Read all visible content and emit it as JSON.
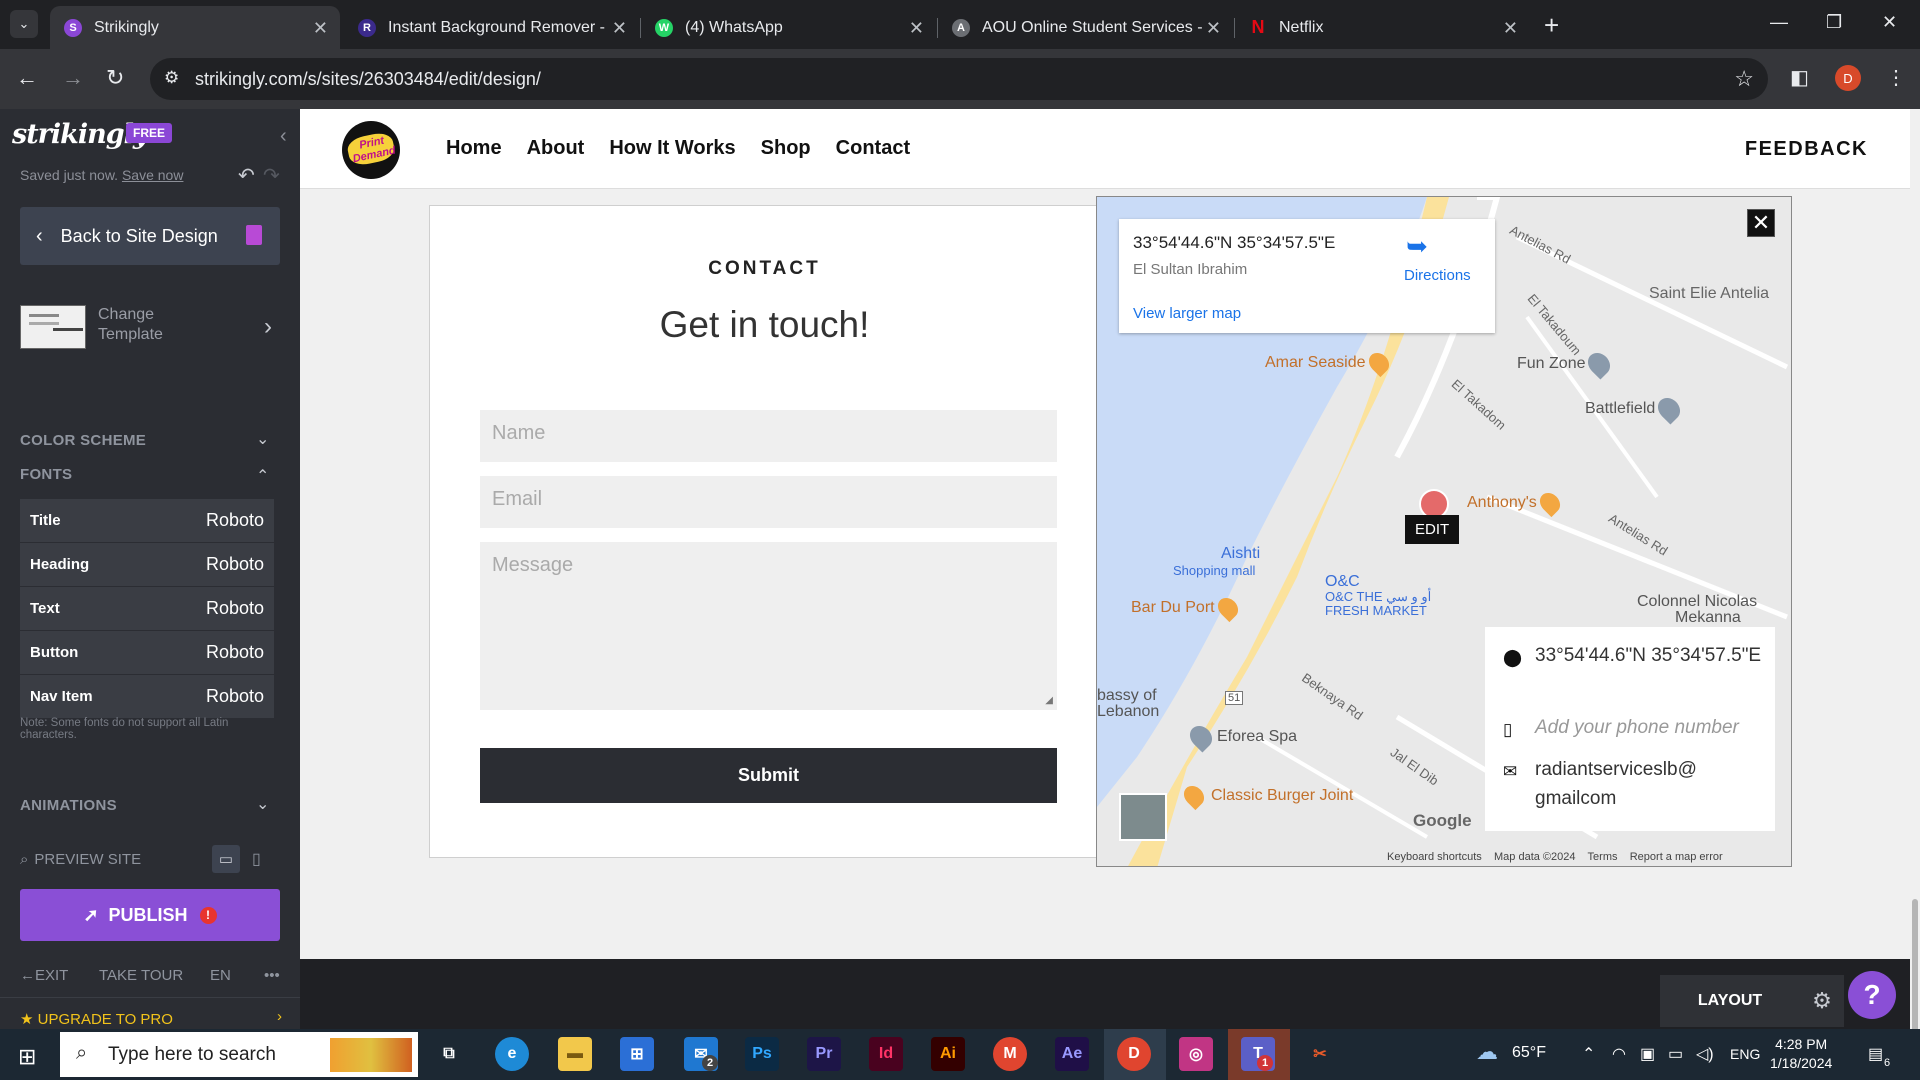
{
  "browser": {
    "tabs": [
      {
        "title": "Strikingly",
        "favicon": "S",
        "color": "#8b47d6",
        "active": true
      },
      {
        "title": "Instant Background Remover - I",
        "favicon": "R",
        "color": "#3b2a8c",
        "active": false
      },
      {
        "title": "(4) WhatsApp",
        "favicon": "W",
        "color": "#25d366",
        "active": false
      },
      {
        "title": "AOU Online Student Services - (",
        "favicon": "A",
        "color": "#6b6e73",
        "active": false
      },
      {
        "title": "Netflix",
        "favicon": "N",
        "color": "#e50914",
        "active": false
      }
    ],
    "url": "strikingly.com/s/sites/26303484/edit/design/",
    "profile_initial": "D"
  },
  "sidebar": {
    "brand": "strikingly",
    "badge": "FREE",
    "saved_text": "Saved just now.",
    "save_now": "Save now",
    "back_label": "Back to Site Design",
    "template_label_1": "Change",
    "template_label_2": "Template",
    "color_scheme": "COLOR SCHEME",
    "fonts_heading": "FONTS",
    "fonts": [
      {
        "key": "Title",
        "value": "Roboto"
      },
      {
        "key": "Heading",
        "value": "Roboto"
      },
      {
        "key": "Text",
        "value": "Roboto"
      },
      {
        "key": "Button",
        "value": "Roboto"
      },
      {
        "key": "Nav Item",
        "value": "Roboto"
      }
    ],
    "note": "Note: Some fonts do not support all Latin characters.",
    "animations": "ANIMATIONS",
    "preview": "PREVIEW SITE",
    "publish": "PUBLISH",
    "exit": "EXIT",
    "tour": "TAKE TOUR",
    "lang": "EN",
    "more": "•••",
    "upgrade": "UPGRADE TO PRO"
  },
  "site": {
    "logo_text": "Print Demand",
    "nav": [
      "Home",
      "About",
      "How It Works",
      "Shop",
      "Contact"
    ],
    "feedback": "FEEDBACK",
    "contact_label": "CONTACT",
    "contact_title": "Get in touch!",
    "name_placeholder": "Name",
    "email_placeholder": "Email",
    "message_placeholder": "Message",
    "submit": "Submit"
  },
  "map": {
    "card_coord": "33°54'44.6\"N 35°34'57.5\"E",
    "card_place": "El Sultan Ibrahim",
    "directions": "Directions",
    "larger_map": "View larger map",
    "places": [
      "Antelias Rd",
      "Saint Elie Antelia",
      "El Takadoum",
      "Amar Seaside",
      "Fun Zone",
      "Battlefield",
      "El Takadom",
      "Anthony's",
      "Antelias Rd",
      "Aishti",
      "Shopping mall",
      "O&C",
      "O&C THE أو و سي",
      "FRESH MARKET",
      "Bar Du Port",
      "Colonnel Nicolas",
      "Mekanna",
      "bassy of",
      "Lebanon",
      "Beknaya Rd",
      "Eforea Spa",
      "Jal El Dib",
      "Classic Burger Joint",
      "51"
    ],
    "edit": "EDIT",
    "info_coord": "33°54'44.6\"N 35°34'57.5\"E",
    "info_phone": "Add your phone number",
    "info_email": "radiantserviceslb@ gmailcom",
    "google": "Google",
    "attribution": [
      "Keyboard shortcuts",
      "Map data ©2024",
      "Terms",
      "Report a map error"
    ]
  },
  "editor": {
    "layout": "LAYOUT",
    "help": "?"
  },
  "taskbar": {
    "search": "Type here to search",
    "weather": "65°F",
    "lang": "ENG",
    "time": "4:28 PM",
    "date": "1/18/2024",
    "notifications": "6",
    "mail_badge": "2",
    "teams_badge": "1"
  }
}
